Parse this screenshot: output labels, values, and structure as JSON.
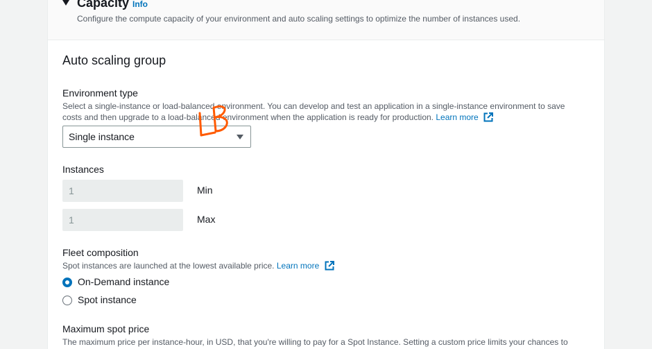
{
  "capacity": {
    "title": "Capacity",
    "info": "Info",
    "description": "Configure the compute capacity of your environment and auto scaling settings to optimize the number of instances used."
  },
  "auto_scaling": {
    "title": "Auto scaling group",
    "env_type": {
      "label": "Environment type",
      "desc_line1": "Select a single-instance or load-balanced environment. You can develop and test an application in a single-instance environment to save",
      "desc_line2": "costs and then upgrade to a load-balanced environment when the application is ready for production.",
      "learn_more": "Learn more",
      "selected": "Single instance"
    },
    "instances": {
      "label": "Instances",
      "min_value": "1",
      "min_label": "Min",
      "max_value": "1",
      "max_label": "Max"
    },
    "fleet": {
      "label": "Fleet composition",
      "description": "Spot instances are launched at the lowest available price.",
      "learn_more": "Learn more",
      "option_on_demand": "On-Demand instance",
      "option_spot": "Spot instance",
      "selected": "On-Demand instance"
    },
    "spot_price": {
      "label": "Maximum spot price",
      "description": "The maximum price per instance-hour, in USD, that you're willing to pay for a Spot Instance. Setting a custom price limits your chances to"
    }
  },
  "annotation": {
    "handwritten_text": "LB",
    "color": "#ff5a00"
  },
  "colors": {
    "link": "#0073bb",
    "text": "#16191f",
    "secondary": "#545b64"
  }
}
